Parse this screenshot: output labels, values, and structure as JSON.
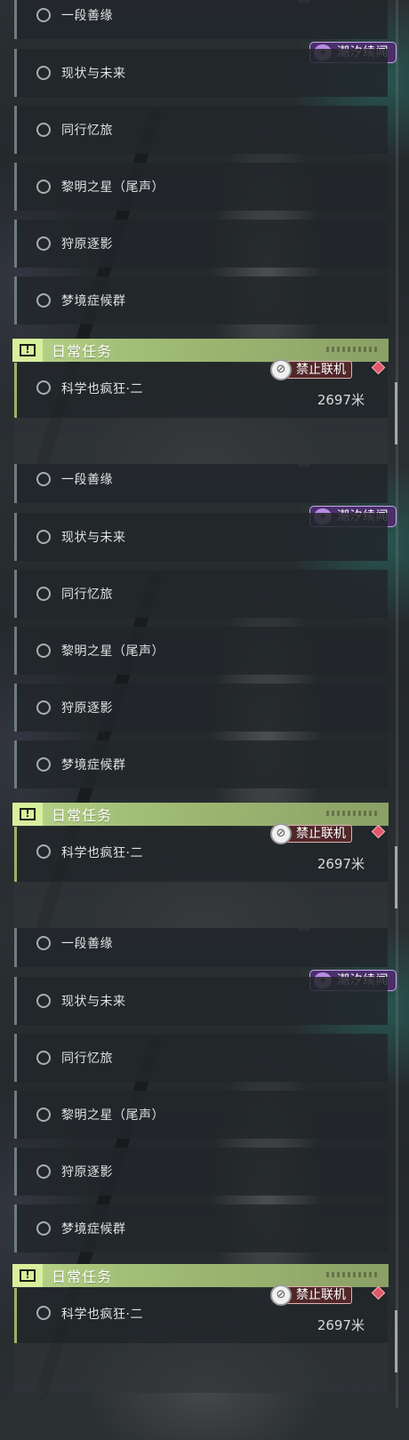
{
  "quests": [
    {
      "label": "一段善缘"
    },
    {
      "label": "现状与未来"
    },
    {
      "label": "同行忆旅"
    },
    {
      "label": "黎明之星（尾声）"
    },
    {
      "label": "狩原逐影"
    },
    {
      "label": "梦境症候群"
    }
  ],
  "event_badge": {
    "label": "潮汐续闻",
    "icon": "tide-event-icon"
  },
  "daily_section": {
    "title": "日常任务",
    "icon": "exclamation-icon"
  },
  "daily_quest": {
    "label": "科学也疯狂·二",
    "distance": "2697米"
  },
  "coop_status": {
    "label": "禁止联机",
    "icon": "no-coop-icon",
    "marker": "red-diamond-marker"
  },
  "colors": {
    "badge_purple": "#4b2f6b",
    "section_green": "#b9d58a",
    "diamond_red": "#e0586a"
  }
}
